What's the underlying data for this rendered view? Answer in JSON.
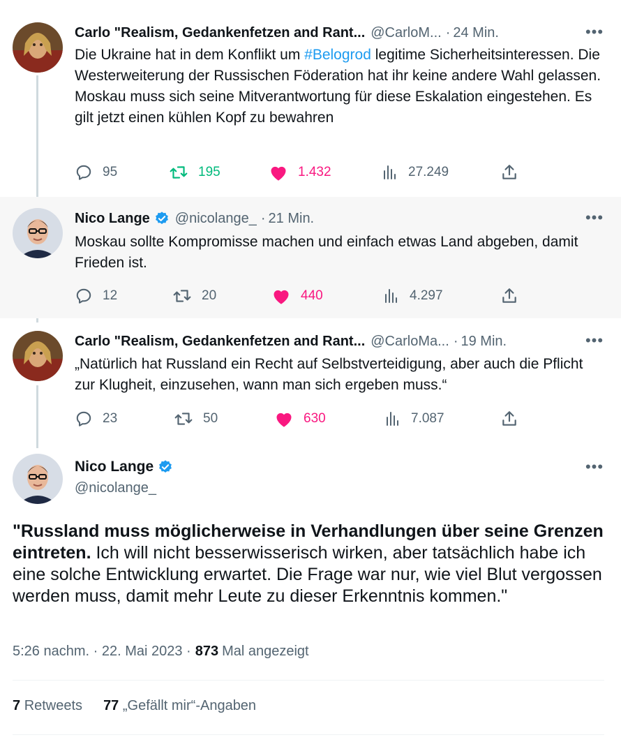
{
  "tweets": [
    {
      "name": "Carlo \"Realism, Gedankenfetzen and Rant...",
      "handle": "@CarloM...",
      "sep": "·",
      "time": "24 Min.",
      "text_pre": "Die Ukraine hat in dem Konflikt um ",
      "hashtag": "#Belogrod",
      "text_post": " legitime Sicherheitsinteressen. Die Westerweiterung der Russischen Föderation hat ihr keine andere Wahl gelassen. Moskau muss sich seine Mitverantwortung für diese Eskalation eingestehen. Es gilt jetzt einen kühlen Kopf zu bewahren",
      "replies": "95",
      "retweets": "195",
      "likes": "1.432",
      "views": "27.249"
    },
    {
      "name": "Nico Lange",
      "handle": "@nicolange_",
      "sep": "·",
      "time": "21 Min.",
      "text": "Moskau sollte Kompromisse machen und einfach etwas Land abgeben, damit Frieden ist.",
      "replies": "12",
      "retweets": "20",
      "likes": "440",
      "views": "4.297"
    },
    {
      "name": "Carlo \"Realism, Gedankenfetzen and Rant...",
      "handle": "@CarloMa...",
      "sep": "·",
      "time": "19 Min.",
      "text": "„Natürlich hat Russland ein Recht auf Selbstverteidigung, aber auch die Pflicht zur Klugheit, einzusehen, wann man sich ergeben muss.“",
      "replies": "23",
      "retweets": "50",
      "likes": "630",
      "views": "7.087"
    }
  ],
  "main_tweet": {
    "name": "Nico Lange",
    "handle": "@nicolange_",
    "bold_text": "\"Russland muss möglicherweise in Verhandlungen über seine Grenzen eintreten.",
    "rest_text": " Ich will nicht besserwisserisch wirken, aber tatsächlich habe ich eine solche Entwicklung erwartet. Die Frage war nur, wie viel Blut vergossen werden muss, damit mehr Leute zu dieser Erkenntnis kommen.\"",
    "timestamp": "5:26 nachm. · 22. Mai 2023 ·",
    "views_count": "873",
    "views_label": "Mal angezeigt",
    "retweets_count": "7",
    "retweets_label": "Retweets",
    "likes_count": "77",
    "likes_label": "„Gefällt mir“-Angaben"
  },
  "colors": {
    "accent": "#1d9bf0",
    "retweet_active": "#00ba7c",
    "like_active": "#f91880",
    "secondary_text": "#536471",
    "highlight_bg": "#f7f7f7"
  },
  "icons": [
    "reply-icon",
    "retweet-icon",
    "like-icon",
    "views-icon",
    "share-icon",
    "more-icon",
    "verified-icon"
  ]
}
